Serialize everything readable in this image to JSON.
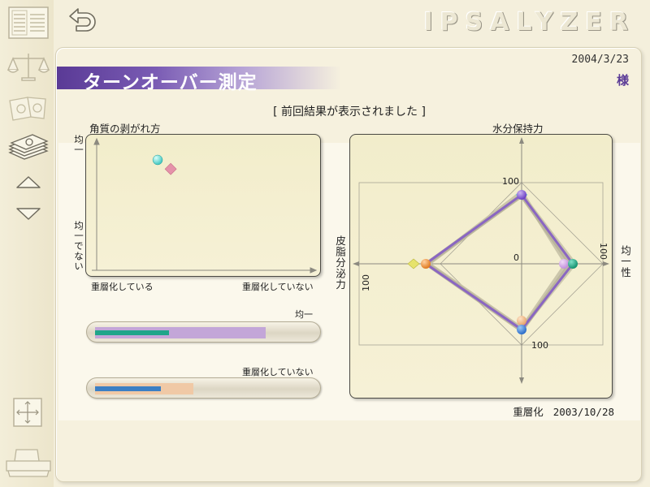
{
  "app": {
    "logo": "IPSALYZER"
  },
  "header": {
    "title": "ターンオーバー測定",
    "date": "2004/3/23",
    "honorific": "様"
  },
  "notice": "[ 前回結果が表示されました ]",
  "scatter": {
    "title": "角質の剥がれ方",
    "y_top": "均一",
    "y_bottom": "均一でない",
    "x_left": "重層化している",
    "x_right": "重層化していない"
  },
  "bars": {
    "uniform_label": "均一",
    "uniform_current": 0.34,
    "uniform_previous": 0.78,
    "layer_label": "重層化していない",
    "layer_current": 0.3,
    "layer_previous": 0.45
  },
  "radar": {
    "top": "水分保持力",
    "left": "皮脂分泌力",
    "right": "均一性",
    "bottom": "重層化",
    "bottom_date": "2003/10/28",
    "tick": "100",
    "center": "0"
  },
  "chart_data": [
    {
      "type": "scatter",
      "title": "角質の剥がれ方",
      "series": [
        {
          "name": "",
          "points": [
            {
              "x": 0.28,
              "y": 0.85,
              "color": "#3fc6bf"
            }
          ]
        },
        {
          "name": "",
          "points": [
            {
              "x": 0.34,
              "y": 0.78,
              "color": "#e592a9"
            }
          ]
        }
      ]
    },
    {
      "type": "radar",
      "axes": [
        "水分保持力",
        "均一性",
        "重層化",
        "皮脂分泌力"
      ],
      "max": 100,
      "series": [
        {
          "name": "",
          "values": [
            85,
            65,
            80,
            115
          ],
          "color": "#c9c4a8"
        },
        {
          "name": "",
          "values": [
            88,
            55,
            80,
            115
          ],
          "color": "#c6c1a6"
        },
        {
          "name": "",
          "values": [
            84,
            60,
            82,
            117
          ],
          "color": "#b8b39a"
        },
        {
          "name": "",
          "values": [
            85,
            63,
            81,
            118
          ],
          "color": "#8a66c2"
        }
      ]
    }
  ]
}
